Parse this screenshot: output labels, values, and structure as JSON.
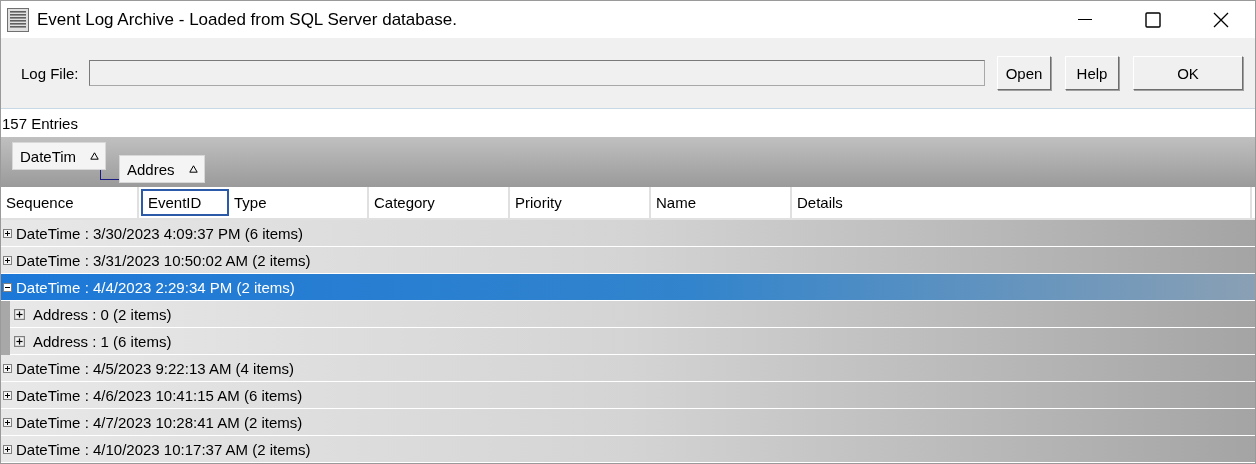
{
  "window": {
    "title": "Event Log Archive - Loaded from SQL Server database."
  },
  "toolbar": {
    "log_file_label": "Log File:",
    "buttons": [
      "Open",
      "Help",
      "OK"
    ]
  },
  "entry_count": "157 Entries",
  "group_by": [
    {
      "label": "DateTim"
    },
    {
      "label": "Addres"
    }
  ],
  "columns": [
    {
      "label": "Sequence",
      "focused": false
    },
    {
      "label": "EventID",
      "focused": true
    },
    {
      "label": "Type",
      "focused": false
    },
    {
      "label": "Category",
      "focused": false
    },
    {
      "label": "Priority",
      "focused": false
    },
    {
      "label": "Name",
      "focused": false
    },
    {
      "label": "Details",
      "focused": false
    }
  ],
  "groups": [
    {
      "label": "DateTime : 3/30/2023 4:09:37 PM (6 items)",
      "expanded": false,
      "selected": false
    },
    {
      "label": "DateTime : 3/31/2023 10:50:02 AM (2 items)",
      "expanded": false,
      "selected": false
    },
    {
      "label": "DateTime : 4/4/2023 2:29:34 PM (2 items)",
      "expanded": true,
      "selected": true,
      "children": [
        {
          "label": "Address : 0 (2 items)",
          "expanded": false
        },
        {
          "label": "Address : 1 (6 items)",
          "expanded": false
        }
      ]
    },
    {
      "label": "DateTime : 4/5/2023 9:22:13 AM (4 items)",
      "expanded": false,
      "selected": false
    },
    {
      "label": "DateTime : 4/6/2023 10:41:15 AM (6 items)",
      "expanded": false,
      "selected": false
    },
    {
      "label": "DateTime : 4/7/2023 10:28:41 AM (2 items)",
      "expanded": false,
      "selected": false
    },
    {
      "label": "DateTime : 4/10/2023 10:17:37 AM (2 items)",
      "expanded": false,
      "selected": false
    }
  ]
}
